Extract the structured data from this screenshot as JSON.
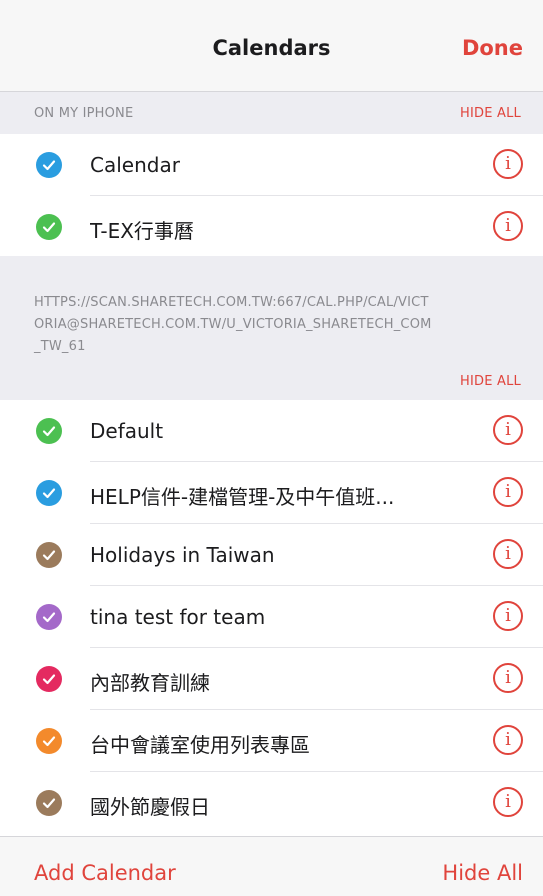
{
  "navbar": {
    "title": "Calendars",
    "done_label": "Done"
  },
  "sections": [
    {
      "title": "ON MY IPHONE",
      "hide_label": "HIDE ALL",
      "items": [
        {
          "label": "Calendar",
          "color": "#2a9de0"
        },
        {
          "label": "T-EX行事曆",
          "color": "#4cc051"
        }
      ]
    },
    {
      "title": "HTTPS://SCAN.SHARETECH.COM.TW:667/CAL.PHP/CAL/VICTORIA@SHARETECH.COM.TW/U_VICTORIA_SHARETECH_COM_TW_61",
      "hide_label": "HIDE ALL",
      "items": [
        {
          "label": "Default",
          "color": "#4cc051"
        },
        {
          "label": "HELP信件-建檔管理-及中午值班...",
          "color": "#2a9de0"
        },
        {
          "label": "Holidays in Taiwan",
          "color": "#9b7b5c"
        },
        {
          "label": "tina test for team",
          "color": "#a469c9"
        },
        {
          "label": "內部教育訓練",
          "color": "#e42a60"
        },
        {
          "label": "台中會議室使用列表專區",
          "color": "#f38a2c"
        },
        {
          "label": "國外節慶假日",
          "color": "#9b7b5c"
        }
      ]
    }
  ],
  "footer": {
    "add_label": "Add Calendar",
    "hide_label": "Hide All"
  },
  "icons": {
    "check": "checkmark-icon",
    "info": "info-icon"
  },
  "accent_color": "#e0443c"
}
